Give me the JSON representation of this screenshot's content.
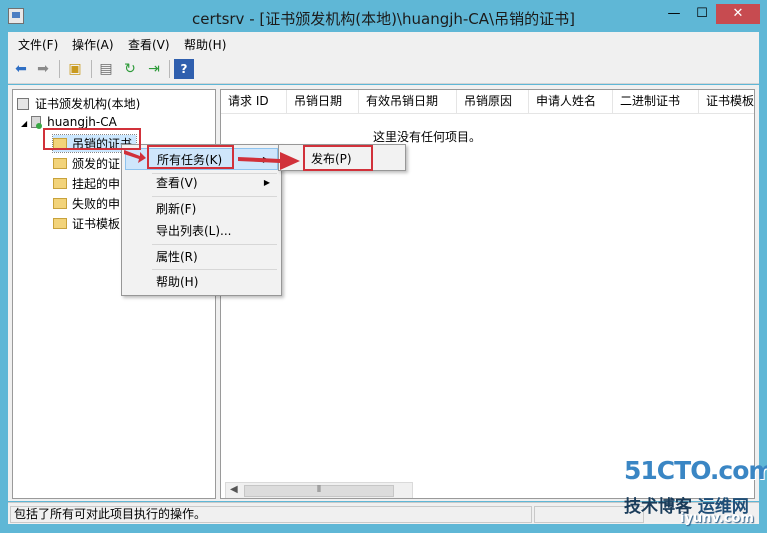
{
  "window": {
    "title": "certsrv - [证书颁发机构(本地)\\huangjh-CA\\吊销的证书]",
    "minimize": "—",
    "maximize": "☐",
    "close": "✕"
  },
  "menubar": {
    "items": [
      "文件(F)",
      "操作(A)",
      "查看(V)",
      "帮助(H)"
    ]
  },
  "toolbar": {
    "icons": [
      "back-icon",
      "forward-icon",
      "up-folder-icon",
      "properties-icon",
      "refresh-icon",
      "export-icon",
      "help-icon"
    ]
  },
  "tree": {
    "root": "证书颁发机构(本地)",
    "ca": "huangjh-CA",
    "folders": [
      "吊销的证书",
      "颁发的证",
      "挂起的申",
      "失败的申",
      "证书模板"
    ]
  },
  "list": {
    "columns": [
      "请求 ID",
      "吊销日期",
      "有效吊销日期",
      "吊销原因",
      "申请人姓名",
      "二进制证书",
      "证书模板"
    ],
    "empty_message": "这里没有任何项目。"
  },
  "context_menu": {
    "items": [
      "所有任务(K)",
      "查看(V)",
      "刷新(F)",
      "导出列表(L)...",
      "属性(R)",
      "帮助(H)"
    ],
    "submenu_item": "发布(P)"
  },
  "statusbar": {
    "text": "包括了所有可对此项目执行的操作。"
  },
  "watermark": {
    "brand": "51CTO.com",
    "slogan": "技术博客",
    "slogan2": "运维网",
    "site": "iyunv.com"
  },
  "colors": {
    "title_bar": "#5fb7d6",
    "annotation_red": "#d1313a",
    "close_button": "#c74b50",
    "highlight": "#cfe6fb"
  }
}
